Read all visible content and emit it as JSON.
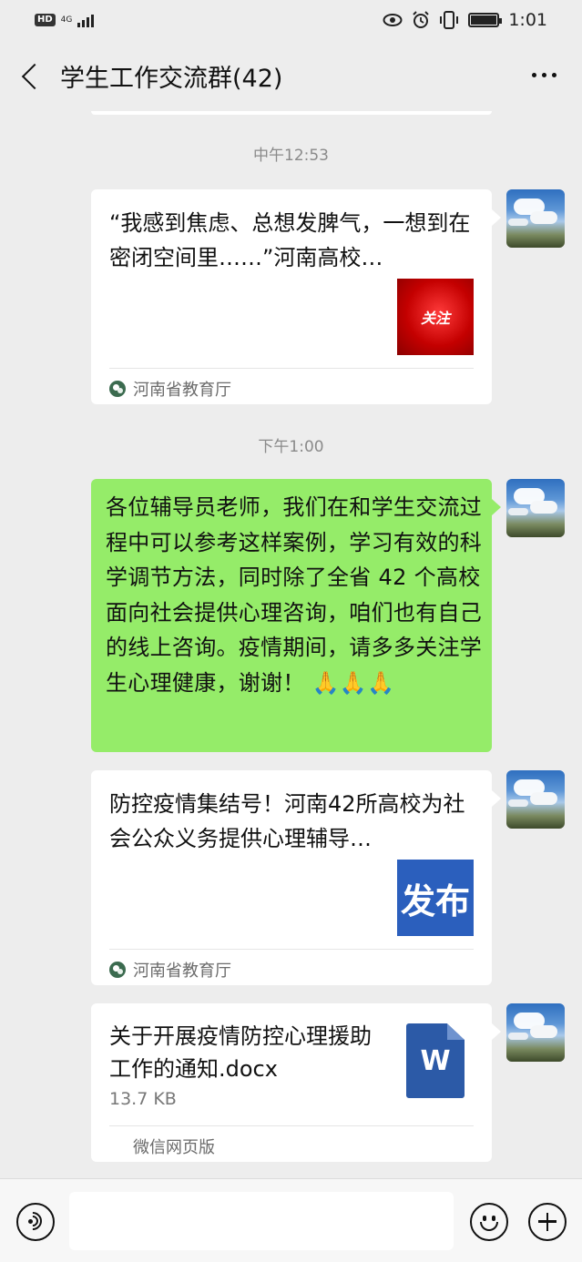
{
  "status_bar": {
    "hd": "HD",
    "network": "4G",
    "time": "1:01",
    "icons": [
      "eye-icon",
      "alarm-icon",
      "vibrate-icon",
      "battery-icon"
    ]
  },
  "header": {
    "title": "学生工作交流群(42)"
  },
  "messages": {
    "time1": "中午12:53",
    "card1": {
      "title": "“我感到焦虑、总想发脾气，一想到在密闭空间里……”河南高校…",
      "thumb_text": "关注",
      "source": "河南省教育厅"
    },
    "time2": "下午1:00",
    "text1": "各位辅导员老师，我们在和学生交流过程中可以参考这样案例，学习有效的科学调节方法，同时除了全省 42 个高校面向社会提供心理咨询，咱们也有自己的线上咨询。疫情期间，请多多关注学生心理健康，谢谢！ 🙏🙏🙏",
    "card2": {
      "title": "防控疫情集结号！河南42所高校为社会公众义务提供心理辅导…",
      "thumb_text": "发布",
      "source": "河南省教育厅"
    },
    "file": {
      "name": "关于开展疫情防控心理援助工作的通知.docx",
      "size": "13.7 KB",
      "icon_letter": "W",
      "source": "微信网页版"
    }
  },
  "colors": {
    "chat_bg": "#ededed",
    "sent_bubble": "#95ec69",
    "card_bubble": "#ffffff",
    "word_blue": "#2c5aa7"
  }
}
